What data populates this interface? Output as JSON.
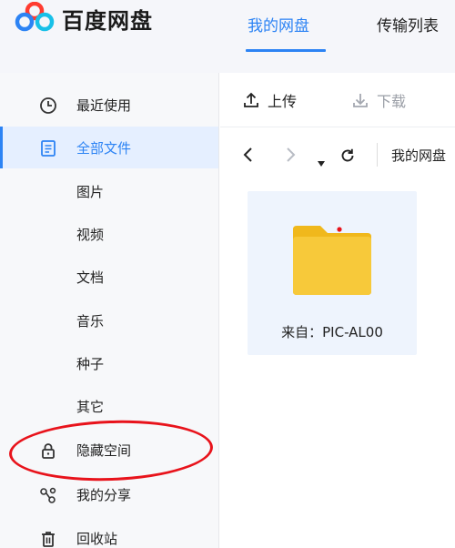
{
  "app": {
    "logo_text": "百度网盘",
    "accent_color": "#2c83f4",
    "logo_colors": [
      "#ff3b30",
      "#2c83f4",
      "#18c0e8"
    ]
  },
  "header": {
    "tabs": [
      {
        "label": "我的网盘",
        "active": true
      },
      {
        "label": "传输列表",
        "active": false
      }
    ]
  },
  "sidebar": {
    "items": [
      {
        "label": "最近使用",
        "icon": "clock-icon",
        "active": false
      },
      {
        "label": "全部文件",
        "icon": "document-icon",
        "active": true
      },
      {
        "label": "图片",
        "icon": "",
        "active": false
      },
      {
        "label": "视频",
        "icon": "",
        "active": false
      },
      {
        "label": "文档",
        "icon": "",
        "active": false
      },
      {
        "label": "音乐",
        "icon": "",
        "active": false
      },
      {
        "label": "种子",
        "icon": "",
        "active": false
      },
      {
        "label": "其它",
        "icon": "",
        "active": false
      },
      {
        "label": "隐藏空间",
        "icon": "lock-icon",
        "active": false
      },
      {
        "label": "我的分享",
        "icon": "share-icon",
        "active": false
      },
      {
        "label": "回收站",
        "icon": "trash-icon",
        "active": false
      }
    ]
  },
  "toolbar": {
    "upload_label": "上传",
    "download_label": "下载"
  },
  "nav": {
    "back_icon": "chevron-left-icon",
    "forward_icon": "chevron-right-icon",
    "dropdown_icon": "caret-down-icon",
    "refresh_icon": "refresh-icon",
    "breadcrumb": "我的网盘"
  },
  "files": [
    {
      "name": "来自：PIC-AL00",
      "icon": "folder-icon",
      "folder_color": "#f5c32c"
    }
  ],
  "annotation": {
    "color": "#e8131b"
  }
}
